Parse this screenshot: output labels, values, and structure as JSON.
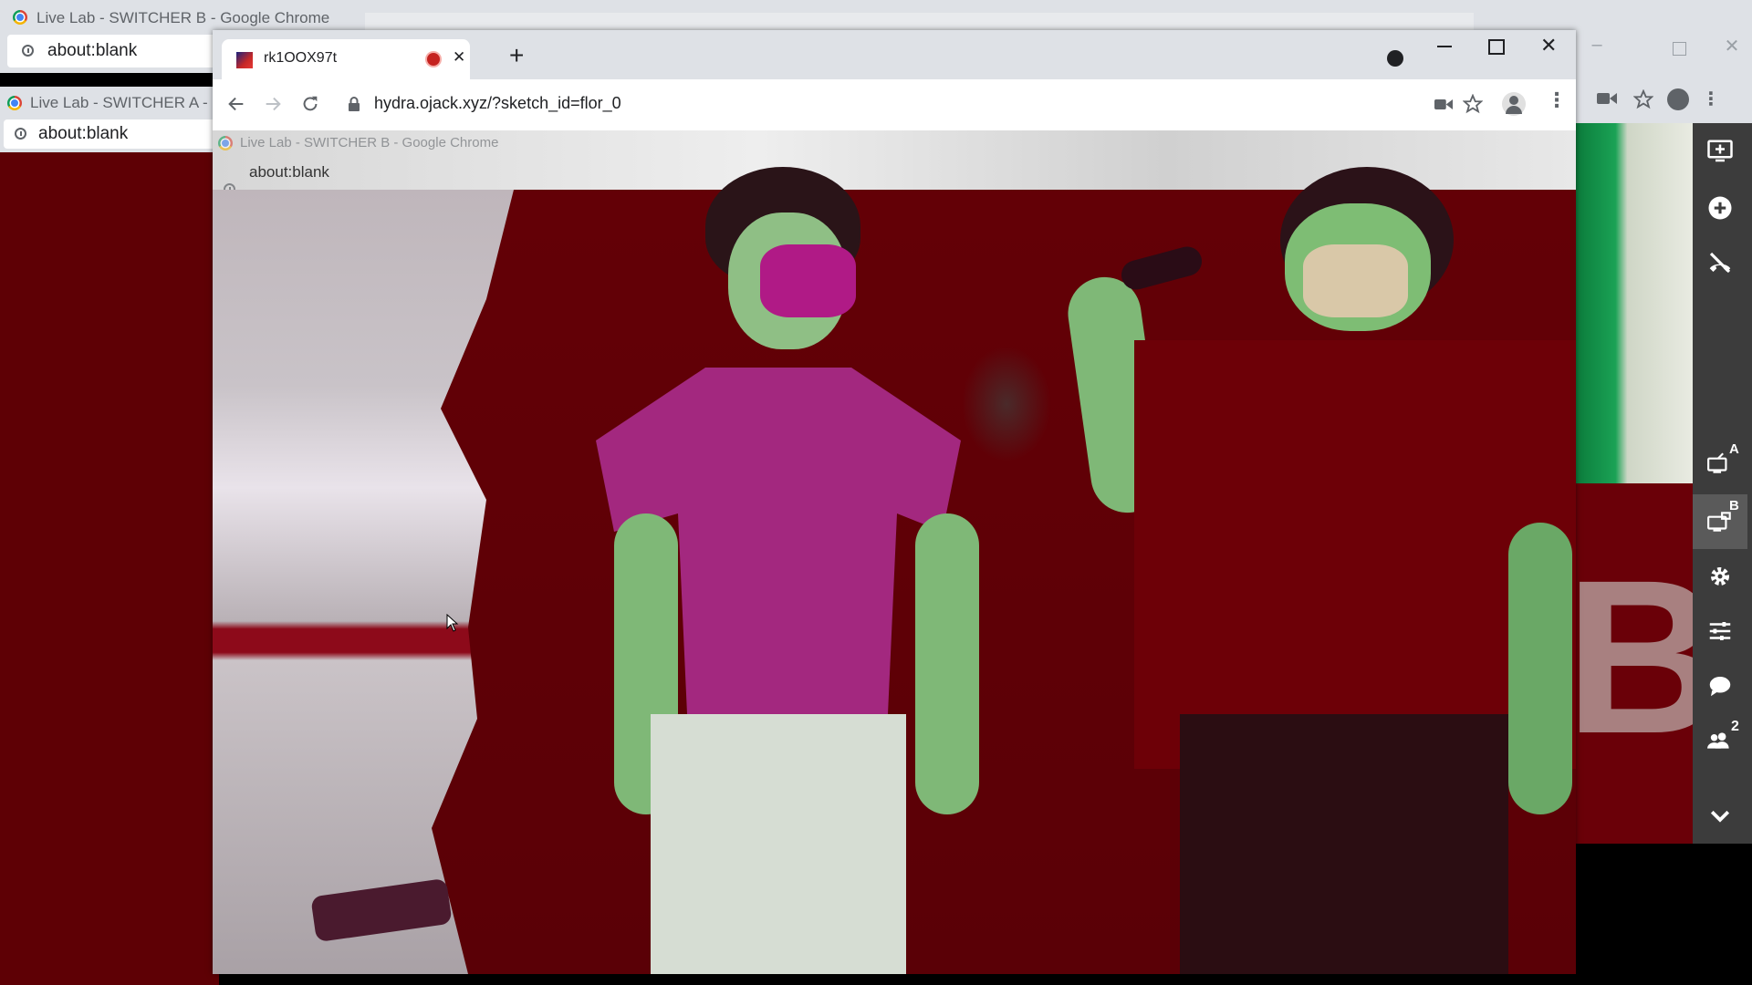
{
  "background_windows": {
    "switcher_b": {
      "title": "Live Lab - SWITCHER B - Google Chrome",
      "address": "about:blank"
    },
    "switcher_a": {
      "title": "Live Lab - SWITCHER A - Goog",
      "address": "about:blank"
    },
    "overlay_title": "Live Lab - SWITCHER B - Google Chrome",
    "overlay_address": "about:blank",
    "right_video_letter": "B"
  },
  "main_window": {
    "tab": {
      "title": "rk1OOX97t"
    },
    "new_tab_symbol": "+",
    "address_bar": {
      "url": "hydra.ojack.xyz/?sketch_id=flor_0"
    }
  },
  "sidebar": {
    "buttons": [
      {
        "icon": "add-screen-icon"
      },
      {
        "icon": "add-circle-icon"
      },
      {
        "icon": "hang-up-icon"
      },
      {
        "icon": "switcher-a-icon",
        "badge": "A"
      },
      {
        "icon": "switcher-b-icon",
        "badge": "B"
      },
      {
        "icon": "gear-icon"
      },
      {
        "icon": "sliders-icon"
      },
      {
        "icon": "chat-icon"
      },
      {
        "icon": "users-icon",
        "badge": "2"
      },
      {
        "icon": "chevron-down-icon"
      }
    ]
  },
  "colors": {
    "video_bg": "#640006",
    "sidebar_bg": "#3c3c3c",
    "record_dot": "#c5221f"
  }
}
